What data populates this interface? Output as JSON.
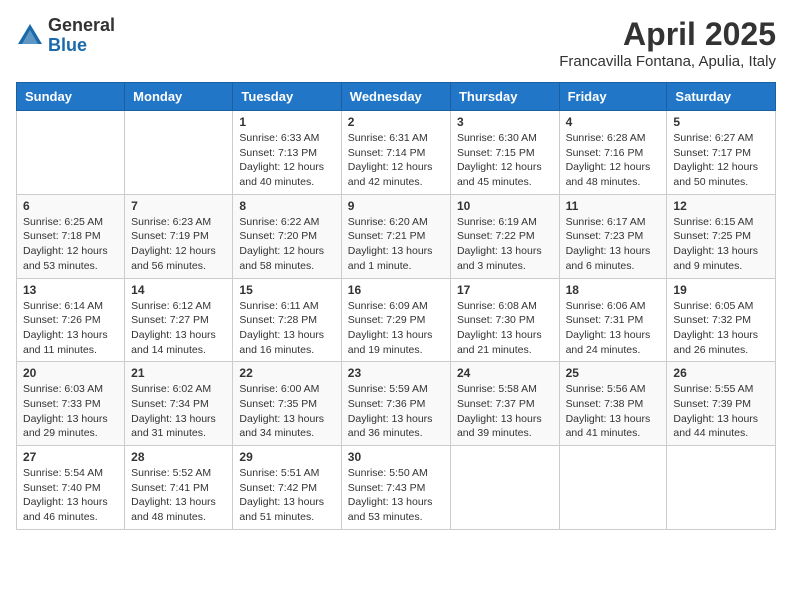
{
  "logo": {
    "general": "General",
    "blue": "Blue"
  },
  "title": "April 2025",
  "location": "Francavilla Fontana, Apulia, Italy",
  "days_of_week": [
    "Sunday",
    "Monday",
    "Tuesday",
    "Wednesday",
    "Thursday",
    "Friday",
    "Saturday"
  ],
  "weeks": [
    [
      {
        "day": "",
        "info": ""
      },
      {
        "day": "",
        "info": ""
      },
      {
        "day": "1",
        "info": "Sunrise: 6:33 AM\nSunset: 7:13 PM\nDaylight: 12 hours\nand 40 minutes."
      },
      {
        "day": "2",
        "info": "Sunrise: 6:31 AM\nSunset: 7:14 PM\nDaylight: 12 hours\nand 42 minutes."
      },
      {
        "day": "3",
        "info": "Sunrise: 6:30 AM\nSunset: 7:15 PM\nDaylight: 12 hours\nand 45 minutes."
      },
      {
        "day": "4",
        "info": "Sunrise: 6:28 AM\nSunset: 7:16 PM\nDaylight: 12 hours\nand 48 minutes."
      },
      {
        "day": "5",
        "info": "Sunrise: 6:27 AM\nSunset: 7:17 PM\nDaylight: 12 hours\nand 50 minutes."
      }
    ],
    [
      {
        "day": "6",
        "info": "Sunrise: 6:25 AM\nSunset: 7:18 PM\nDaylight: 12 hours\nand 53 minutes."
      },
      {
        "day": "7",
        "info": "Sunrise: 6:23 AM\nSunset: 7:19 PM\nDaylight: 12 hours\nand 56 minutes."
      },
      {
        "day": "8",
        "info": "Sunrise: 6:22 AM\nSunset: 7:20 PM\nDaylight: 12 hours\nand 58 minutes."
      },
      {
        "day": "9",
        "info": "Sunrise: 6:20 AM\nSunset: 7:21 PM\nDaylight: 13 hours\nand 1 minute."
      },
      {
        "day": "10",
        "info": "Sunrise: 6:19 AM\nSunset: 7:22 PM\nDaylight: 13 hours\nand 3 minutes."
      },
      {
        "day": "11",
        "info": "Sunrise: 6:17 AM\nSunset: 7:23 PM\nDaylight: 13 hours\nand 6 minutes."
      },
      {
        "day": "12",
        "info": "Sunrise: 6:15 AM\nSunset: 7:25 PM\nDaylight: 13 hours\nand 9 minutes."
      }
    ],
    [
      {
        "day": "13",
        "info": "Sunrise: 6:14 AM\nSunset: 7:26 PM\nDaylight: 13 hours\nand 11 minutes."
      },
      {
        "day": "14",
        "info": "Sunrise: 6:12 AM\nSunset: 7:27 PM\nDaylight: 13 hours\nand 14 minutes."
      },
      {
        "day": "15",
        "info": "Sunrise: 6:11 AM\nSunset: 7:28 PM\nDaylight: 13 hours\nand 16 minutes."
      },
      {
        "day": "16",
        "info": "Sunrise: 6:09 AM\nSunset: 7:29 PM\nDaylight: 13 hours\nand 19 minutes."
      },
      {
        "day": "17",
        "info": "Sunrise: 6:08 AM\nSunset: 7:30 PM\nDaylight: 13 hours\nand 21 minutes."
      },
      {
        "day": "18",
        "info": "Sunrise: 6:06 AM\nSunset: 7:31 PM\nDaylight: 13 hours\nand 24 minutes."
      },
      {
        "day": "19",
        "info": "Sunrise: 6:05 AM\nSunset: 7:32 PM\nDaylight: 13 hours\nand 26 minutes."
      }
    ],
    [
      {
        "day": "20",
        "info": "Sunrise: 6:03 AM\nSunset: 7:33 PM\nDaylight: 13 hours\nand 29 minutes."
      },
      {
        "day": "21",
        "info": "Sunrise: 6:02 AM\nSunset: 7:34 PM\nDaylight: 13 hours\nand 31 minutes."
      },
      {
        "day": "22",
        "info": "Sunrise: 6:00 AM\nSunset: 7:35 PM\nDaylight: 13 hours\nand 34 minutes."
      },
      {
        "day": "23",
        "info": "Sunrise: 5:59 AM\nSunset: 7:36 PM\nDaylight: 13 hours\nand 36 minutes."
      },
      {
        "day": "24",
        "info": "Sunrise: 5:58 AM\nSunset: 7:37 PM\nDaylight: 13 hours\nand 39 minutes."
      },
      {
        "day": "25",
        "info": "Sunrise: 5:56 AM\nSunset: 7:38 PM\nDaylight: 13 hours\nand 41 minutes."
      },
      {
        "day": "26",
        "info": "Sunrise: 5:55 AM\nSunset: 7:39 PM\nDaylight: 13 hours\nand 44 minutes."
      }
    ],
    [
      {
        "day": "27",
        "info": "Sunrise: 5:54 AM\nSunset: 7:40 PM\nDaylight: 13 hours\nand 46 minutes."
      },
      {
        "day": "28",
        "info": "Sunrise: 5:52 AM\nSunset: 7:41 PM\nDaylight: 13 hours\nand 48 minutes."
      },
      {
        "day": "29",
        "info": "Sunrise: 5:51 AM\nSunset: 7:42 PM\nDaylight: 13 hours\nand 51 minutes."
      },
      {
        "day": "30",
        "info": "Sunrise: 5:50 AM\nSunset: 7:43 PM\nDaylight: 13 hours\nand 53 minutes."
      },
      {
        "day": "",
        "info": ""
      },
      {
        "day": "",
        "info": ""
      },
      {
        "day": "",
        "info": ""
      }
    ]
  ]
}
